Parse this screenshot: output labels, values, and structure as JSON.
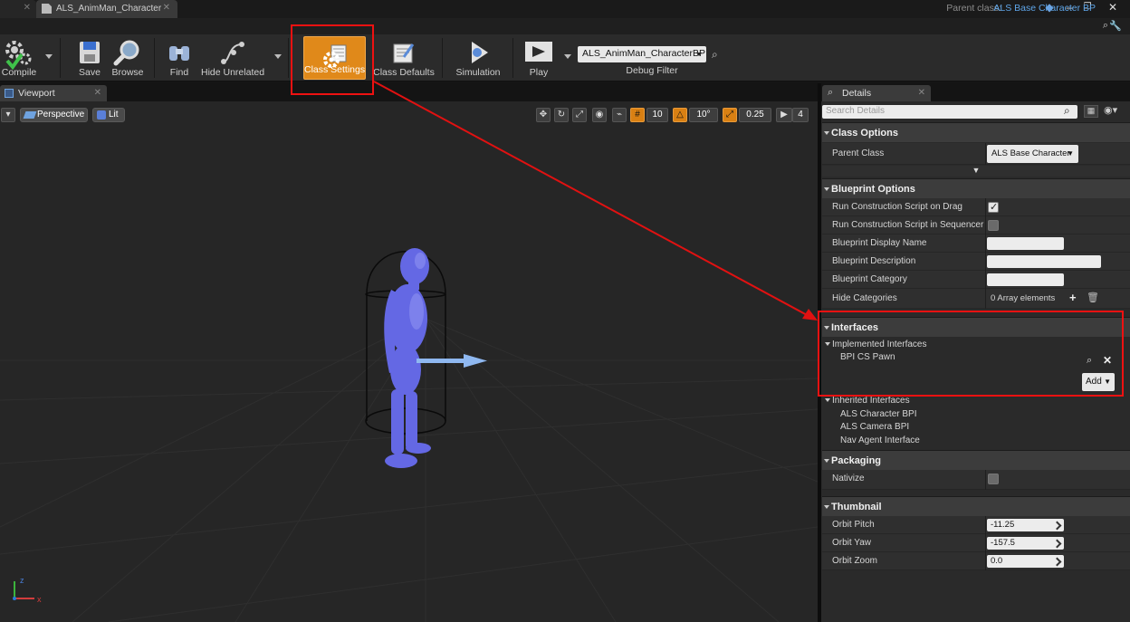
{
  "document_tab": "ALS_AnimMan_Character",
  "parent_class_label": "Parent class:",
  "parent_class_value": "ALS Base Character BP",
  "toolbar": {
    "compile": "Compile",
    "save": "Save",
    "browse": "Browse",
    "find": "Find",
    "hide_unrelated": "Hide Unrelated",
    "class_settings": "Class Settings",
    "class_defaults": "Class Defaults",
    "simulation": "Simulation",
    "play": "Play",
    "debug_select": "ALS_AnimMan_CharacterBP",
    "debug_filter": "Debug Filter"
  },
  "viewport": {
    "tab": "Viewport",
    "perspective": "Perspective",
    "lit": "Lit",
    "grid_snap": "10",
    "rot_snap": "10°",
    "scale_snap": "0.25",
    "cam_speed": "4"
  },
  "details": {
    "tab": "Details",
    "search_placeholder": "Search Details",
    "class_options": "Class Options",
    "parent_class_row": "Parent Class",
    "parent_class_dropdown": "ALS Base Character",
    "blueprint_options": "Blueprint Options",
    "run_construction_drag": "Run Construction Script on Drag",
    "run_construction_seq": "Run Construction Script in Sequencer",
    "bp_display_name": "Blueprint Display Name",
    "bp_description": "Blueprint Description",
    "bp_category": "Blueprint Category",
    "hide_categories": "Hide Categories",
    "hide_categories_value": "0 Array elements",
    "interfaces": "Interfaces",
    "implemented_interfaces": "Implemented Interfaces",
    "implemented_items": [
      "BPI CS Pawn"
    ],
    "add_button": "Add",
    "inherited_interfaces": "Inherited Interfaces",
    "inherited_items": [
      "ALS Character BPI",
      "ALS Camera BPI",
      "Nav Agent Interface"
    ],
    "packaging": "Packaging",
    "nativize": "Nativize",
    "thumbnail": "Thumbnail",
    "orbit_pitch": "Orbit Pitch",
    "orbit_pitch_value": "-11.25",
    "orbit_yaw": "Orbit Yaw",
    "orbit_yaw_value": "-157.5",
    "orbit_zoom": "Orbit Zoom",
    "orbit_zoom_value": "0.0"
  },
  "axis": {
    "x": "x",
    "z": "z"
  },
  "colors": {
    "accent": "#e0891a",
    "annotation": "#e11111",
    "link": "#5ea5e8",
    "mannequin": "#6b6ee8"
  }
}
